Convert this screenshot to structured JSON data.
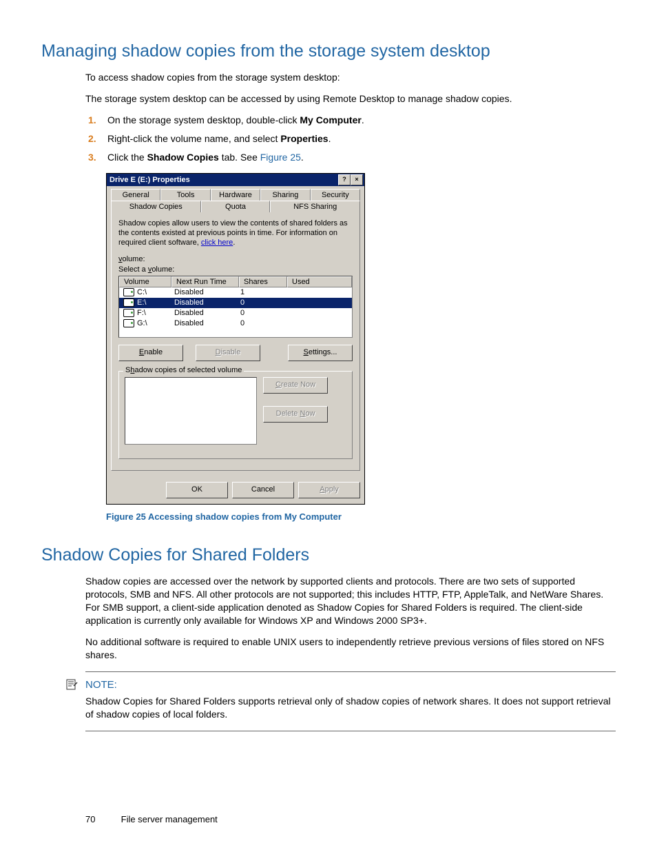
{
  "h1_a": "Managing shadow copies from the storage system desktop",
  "p1": "To access shadow copies from the storage system desktop:",
  "p2": "The storage system desktop can be accessed by using Remote Desktop to manage shadow copies.",
  "step1_a": "On the storage system desktop, double-click ",
  "step1_b": "My Computer",
  "step1_c": ".",
  "step2_a": "Right-click the volume name, and select ",
  "step2_b": "Properties",
  "step2_c": ".",
  "step3_a": "Click the ",
  "step3_b": "Shadow Copies",
  "step3_c": " tab. See ",
  "step3_link": "Figure 25",
  "step3_d": ".",
  "dlg": {
    "title": "Drive E (E:) Properties",
    "help": "?",
    "close": "×",
    "tabs_back": [
      "General",
      "Tools",
      "Hardware",
      "Sharing",
      "Security"
    ],
    "tabs_front": [
      "Shadow Copies",
      "Quota",
      "NFS Sharing"
    ],
    "desc": "Shadow copies allow users to view the contents of shared folders as the contents existed at previous points in time. For information on required client software, ",
    "desc_link": "click here",
    "desc_end": ".",
    "select_label": "Select a volume:",
    "cols": {
      "c1": "Volume",
      "c2": "Next Run Time",
      "c3": "Shares",
      "c4": "Used"
    },
    "rows": [
      {
        "vol": "C:\\",
        "next": "Disabled",
        "shares": "1",
        "used": ""
      },
      {
        "vol": "E:\\",
        "next": "Disabled",
        "shares": "0",
        "used": ""
      },
      {
        "vol": "F:\\",
        "next": "Disabled",
        "shares": "0",
        "used": ""
      },
      {
        "vol": "G:\\",
        "next": "Disabled",
        "shares": "0",
        "used": ""
      }
    ],
    "enable": "Enable",
    "disable": "Disable",
    "settings": "Settings...",
    "group_label": "Shadow copies of selected volume",
    "create": "Create Now",
    "delete": "Delete Now",
    "ok": "OK",
    "cancel": "Cancel",
    "apply": "Apply"
  },
  "fig_caption": "Figure 25 Accessing shadow copies from My Computer",
  "h1_b": "Shadow Copies for Shared Folders",
  "p3": "Shadow copies are accessed over the network by supported clients and protocols. There are two sets of supported protocols, SMB and NFS. All other protocols are not supported; this includes HTTP, FTP, AppleTalk, and NetWare Shares. For SMB support, a client-side application denoted as Shadow Copies for Shared Folders is required. The client-side application is currently only available for Windows XP and Windows 2000 SP3+.",
  "p4": "No additional software is required to enable UNIX users to independently retrieve previous versions of files stored on NFS shares.",
  "note_head": "NOTE:",
  "note_body": "Shadow Copies for Shared Folders supports retrieval only of shadow copies of network shares. It does not support retrieval of shadow copies of local folders.",
  "page_num": "70",
  "footer_text": "File server management"
}
